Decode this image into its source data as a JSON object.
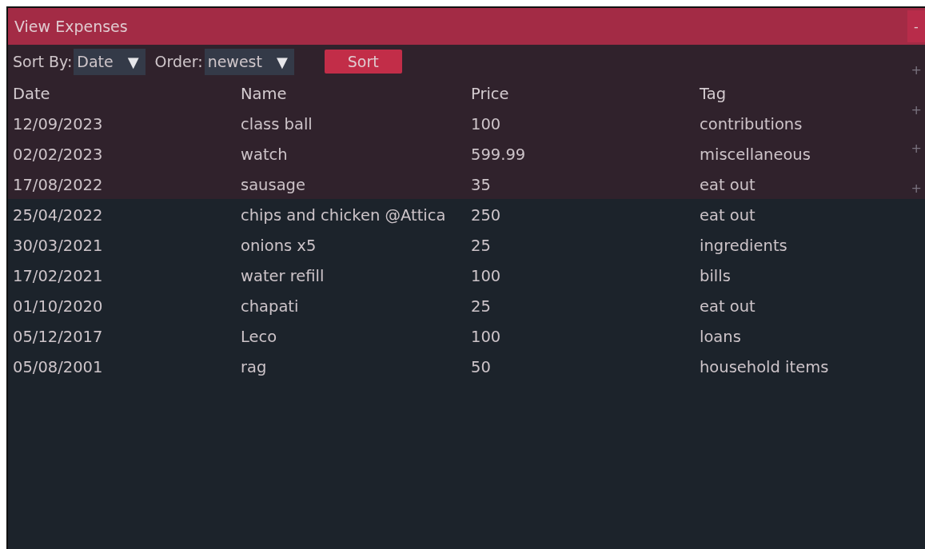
{
  "window": {
    "title": "View Expenses",
    "collapse_button": "-"
  },
  "toolbar": {
    "sort_by": {
      "label": "Sort By:",
      "value": "Date",
      "arrow": "▼"
    },
    "order": {
      "label": "Order:",
      "value": "newest",
      "arrow": "▼"
    },
    "sort_button": "Sort"
  },
  "table": {
    "columns": [
      "Date",
      "Name",
      "Price",
      "Tag"
    ],
    "rows": [
      [
        "12/09/2023",
        "class ball",
        "100",
        "contributions"
      ],
      [
        "02/02/2023",
        "watch",
        "599.99",
        "miscellaneous"
      ],
      [
        "17/08/2022",
        "sausage",
        "35",
        "eat out"
      ],
      [
        "25/04/2022",
        "chips and chicken @Attica",
        "250",
        "eat out"
      ],
      [
        "30/03/2021",
        "onions x5",
        "25",
        "ingredients"
      ],
      [
        "17/02/2021",
        "water refill",
        "100",
        "bills"
      ],
      [
        "01/10/2020",
        "chapati",
        "25",
        "eat out"
      ],
      [
        "05/12/2017",
        "Leco",
        "100",
        "loans"
      ],
      [
        "05/08/2001",
        "rag",
        "50",
        "household items"
      ]
    ]
  },
  "background_headers": [
    {
      "expand": "+"
    },
    {
      "expand": "+"
    },
    {
      "expand": "+"
    },
    {
      "expand": "+"
    }
  ]
}
